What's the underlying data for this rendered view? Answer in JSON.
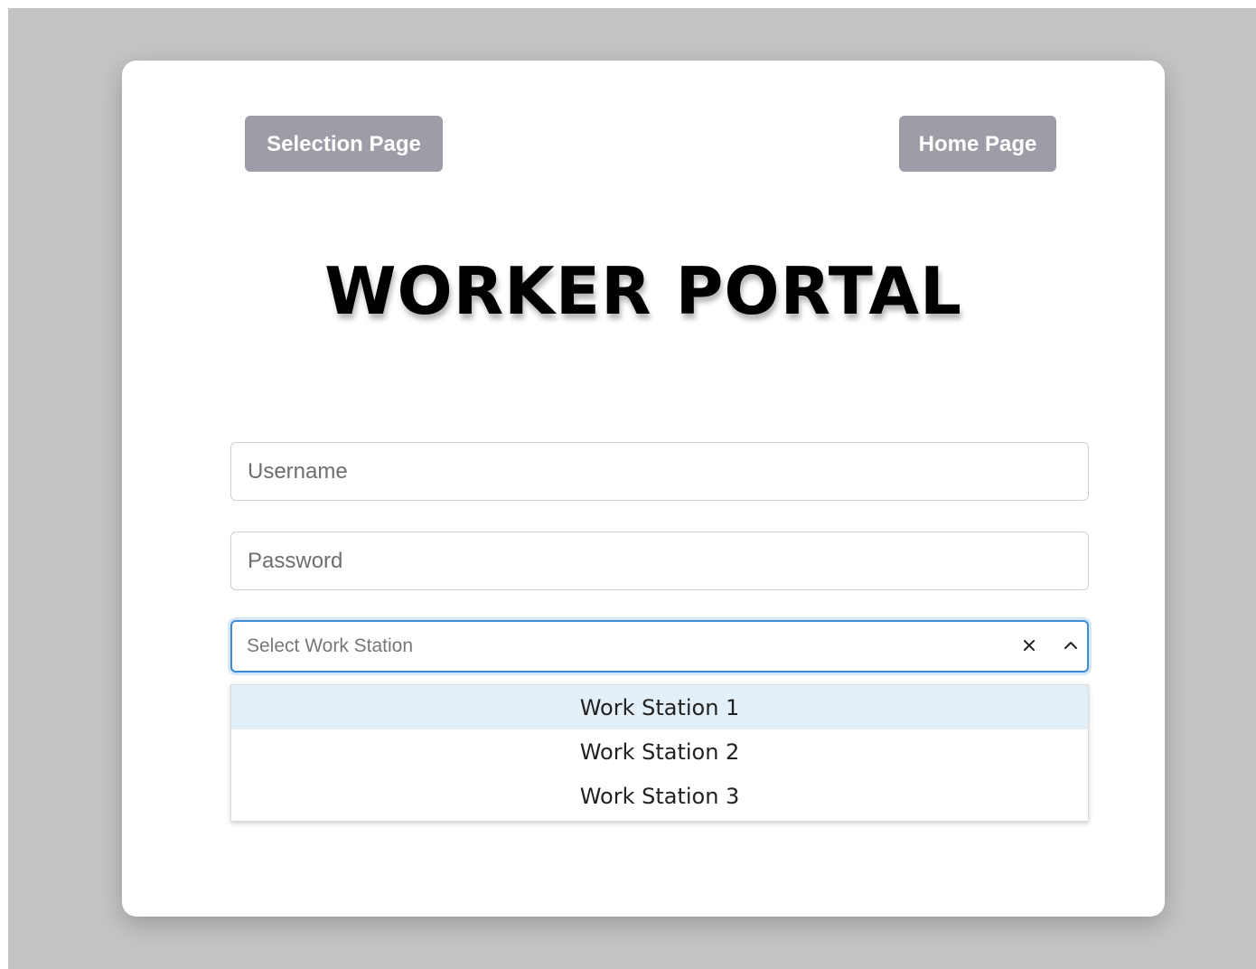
{
  "nav": {
    "selection_label": "Selection Page",
    "home_label": "Home Page"
  },
  "title": "WORKER PORTAL",
  "form": {
    "username_placeholder": "Username",
    "password_placeholder": "Password",
    "workstation_placeholder": "Select Work Station",
    "workstation_options": [
      "Work Station 1",
      "Work Station 2",
      "Work Station 3"
    ],
    "highlighted_option": "Work Station 1"
  },
  "icons": {
    "clear": "close-icon",
    "toggle": "chevron-up-icon"
  },
  "colors": {
    "backdrop": "#c4c4c4",
    "nav_button": "#9d9da8",
    "focus_border": "#3f8bd6",
    "option_highlight": "#e3eff9"
  }
}
